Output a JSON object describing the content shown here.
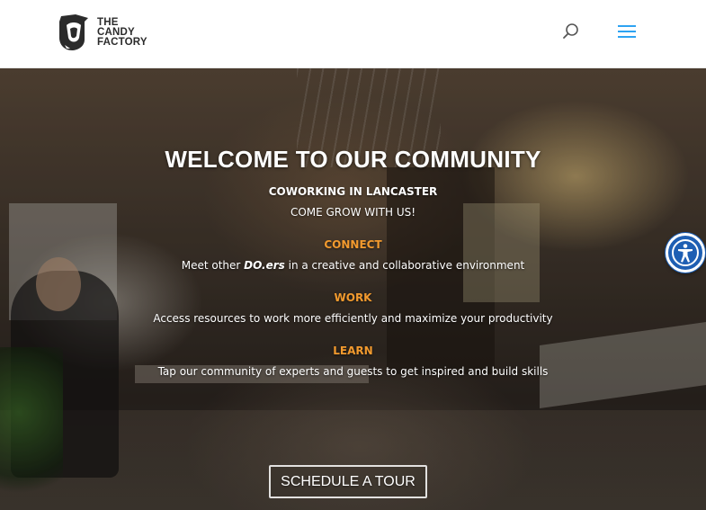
{
  "header": {
    "logo_lines": [
      "THE",
      "CANDY",
      "FACTORY"
    ],
    "search_icon": "search-icon",
    "menu_icon": "hamburger-menu-icon",
    "menu_color": "#2ea3f2"
  },
  "hero": {
    "title": "WELCOME TO OUR COMMUNITY",
    "subtitle": "COWORKING IN LANCASTER",
    "tagline": "COME GROW WITH US!",
    "sections": [
      {
        "heading": "CONNECT",
        "body_prefix": "Meet other ",
        "body_emphasis": "DO.ers",
        "body_suffix": " in a creative and collaborative environment"
      },
      {
        "heading": "WORK",
        "body": "Access resources to work more efficiently and maximize your productivity"
      },
      {
        "heading": "LEARN",
        "body": "Tap our community of experts and guests to get inspired and build skills"
      }
    ],
    "cta_label": "SCHEDULE A TOUR",
    "accent_color": "#f29a2e"
  },
  "accessibility_widget": {
    "icon": "accessibility-icon",
    "color": "#1e5fb3"
  }
}
